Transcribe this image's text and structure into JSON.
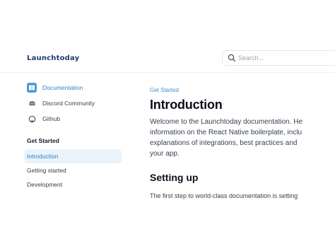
{
  "header": {
    "logo": "Launchtoday",
    "search": {
      "placeholder": "Search..."
    }
  },
  "sidebar": {
    "links": [
      {
        "label": "Documentation",
        "icon": "book-icon",
        "active": true
      },
      {
        "label": "Discord Community",
        "icon": "discord-icon"
      },
      {
        "label": "Github",
        "icon": "github-icon"
      }
    ],
    "section_title": "Get Started",
    "items": [
      {
        "label": "Introduction",
        "active": true
      },
      {
        "label": "Getting started"
      },
      {
        "label": "Development"
      }
    ]
  },
  "main": {
    "eyebrow": "Get Started",
    "title": "Introduction",
    "intro_lines": [
      "Welcome to the Launchtoday documentation. He",
      "information on the React Native boilerplate, inclu",
      "explanations of integrations, best practices and",
      "your app."
    ],
    "section_heading": "Setting up",
    "section_text": "The first step to world-class documentation is setting"
  },
  "colors": {
    "accent": "#2f80c9",
    "active_bg": "#e9f3fc",
    "logo": "#1f3b73"
  }
}
